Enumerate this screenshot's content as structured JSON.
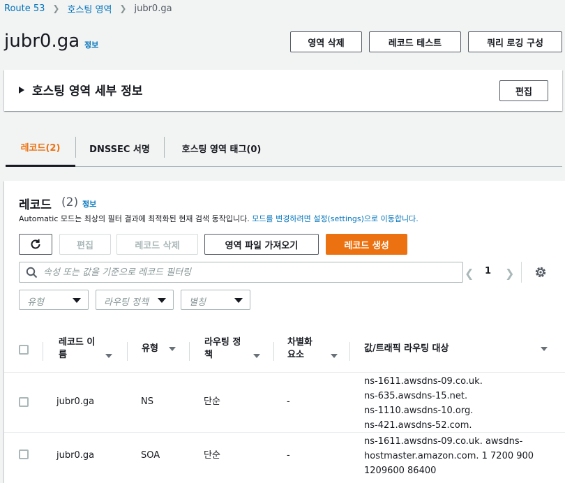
{
  "breadcrumb": {
    "items": [
      "Route 53",
      "호스팅 영역",
      "jubr0.ga"
    ]
  },
  "header": {
    "title": "jubr0.ga",
    "info": "정보",
    "buttons": {
      "delete_zone": "영역 삭제",
      "test_record": "레코드 테스트",
      "query_logging": "쿼리 로깅 구성"
    }
  },
  "details": {
    "title": "호스팅 영역 세부 정보",
    "edit": "편집"
  },
  "tabs": [
    {
      "label": "레코드(2)",
      "active": true
    },
    {
      "label": "DNSSEC 서명",
      "active": false
    },
    {
      "label": "호스팅 영역 태그(0)",
      "active": false
    }
  ],
  "records": {
    "title": "레코드",
    "count": "(2)",
    "info": "정보",
    "desc_prefix": "Automatic 모드는 최상의 필터 결과에 최적화된 현재 검색 동작입니다. ",
    "desc_link": "모드를 변경하려면 설정(settings)으로 이동합니다.",
    "buttons": {
      "edit": "편집",
      "delete": "레코드 삭제",
      "import": "영역 파일 가져오기",
      "create": "레코드 생성"
    },
    "search_placeholder": "속성 또는 값을 기준으로 레코드 필터링",
    "page": "1",
    "filters": [
      "유형",
      "라우팅 정책",
      "별칭"
    ],
    "columns": [
      {
        "line1": "레코드 이",
        "line2": "름"
      },
      {
        "line1": "유형",
        "line2": ""
      },
      {
        "line1": "라우팅 정",
        "line2": "책"
      },
      {
        "line1": "차별화",
        "line2": "요소"
      },
      {
        "line1": "값/트래픽 라우팅 대상",
        "line2": ""
      }
    ],
    "rows": [
      {
        "name": "jubr0.ga",
        "type": "NS",
        "policy": "단순",
        "diff": "-",
        "value": [
          "ns-1611.awsdns-09.co.uk.",
          "ns-635.awsdns-15.net.",
          "ns-1110.awsdns-10.org.",
          "ns-421.awsdns-52.com."
        ]
      },
      {
        "name": "jubr0.ga",
        "type": "SOA",
        "policy": "단순",
        "diff": "-",
        "value": [
          "ns-1611.awsdns-09.co.uk. awsdns-",
          "hostmaster.amazon.com. 1 7200 900",
          "1209600 86400"
        ]
      }
    ]
  },
  "colors": {
    "accent": "#ec7211",
    "link": "#0073bb",
    "text": "#16191f"
  }
}
